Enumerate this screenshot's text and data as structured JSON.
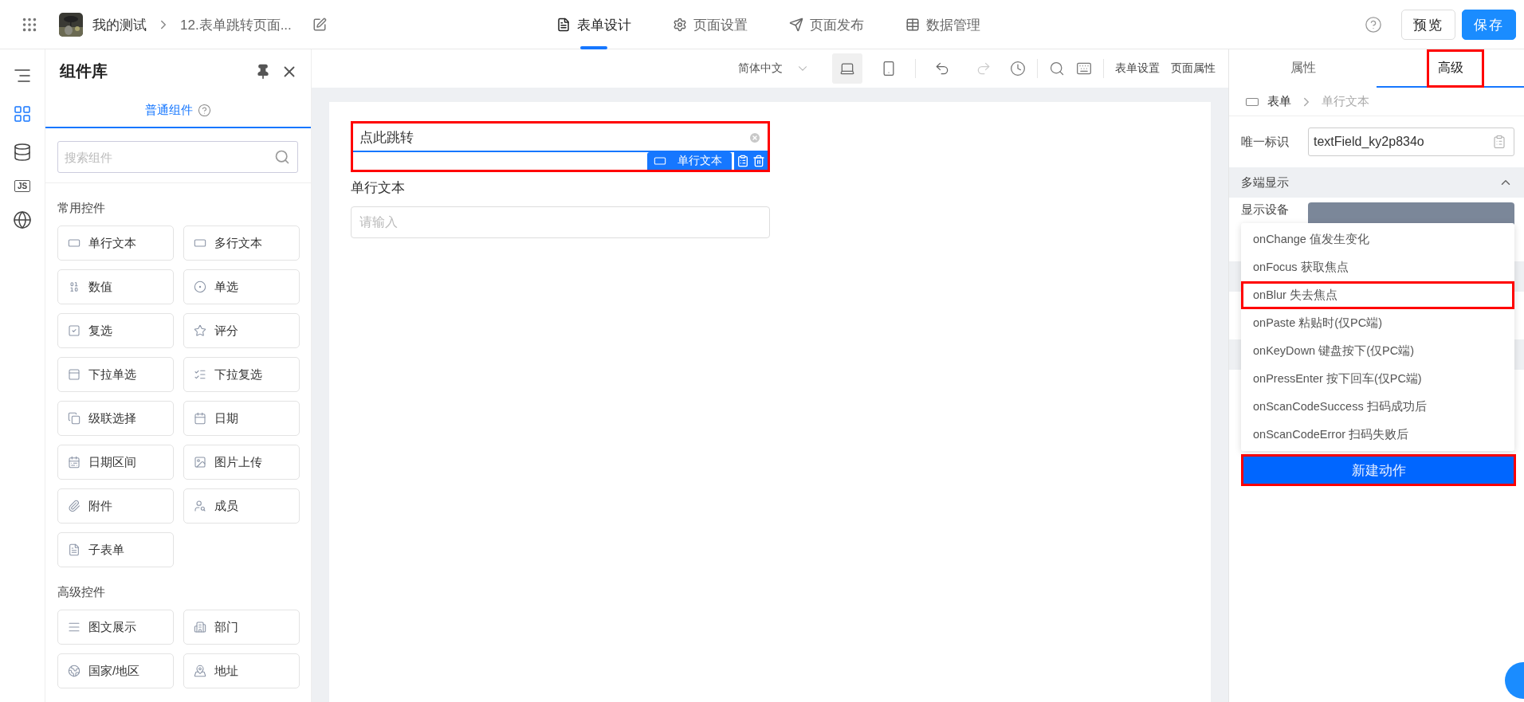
{
  "header": {
    "app": "我的测试",
    "page": "12.表单跳转页面...",
    "tabs": [
      {
        "label": "表单设计",
        "selected": true
      },
      {
        "label": "页面设置",
        "selected": false
      },
      {
        "label": "页面发布",
        "selected": false
      },
      {
        "label": "数据管理",
        "selected": false
      }
    ],
    "buttons": [
      {
        "label": "预览",
        "kind": "secondary"
      },
      {
        "label": "保存",
        "kind": "primary"
      }
    ]
  },
  "rail": [
    {
      "selected": false
    },
    {
      "selected": true
    },
    {
      "selected": false
    },
    {
      "label": "JS",
      "selected": false
    },
    {
      "selected": false
    }
  ],
  "library": {
    "title": "组件库",
    "tab": {
      "label": "普通组件",
      "selected": true
    },
    "search": {
      "placeholder": "搜索组件"
    },
    "sections": [
      {
        "title": "常用控件",
        "items": [
          "单行文本",
          "多行文本",
          "数值",
          "单选",
          "复选",
          "评分",
          "下拉单选",
          "下拉复选",
          "级联选择",
          "日期",
          "日期区间",
          "图片上传",
          "附件",
          "成员",
          "子表单"
        ]
      },
      {
        "title": "高级控件",
        "items": [
          "图文展示",
          "部门",
          "国家/地区",
          "地址"
        ]
      }
    ]
  },
  "toolbar": {
    "language": "简体中文",
    "devices": [
      {
        "selected": true
      },
      {
        "selected": false
      }
    ],
    "history": [
      {
        "disabled": false
      },
      {
        "disabled": true
      }
    ],
    "links": [
      "表单设置",
      "页面属性"
    ]
  },
  "canvas": {
    "selected_field": {
      "value": "点此跳转",
      "tag": "单行文本",
      "highlighted": true
    },
    "fields": [
      {
        "label": "单行文本",
        "placeholder": "请输入"
      }
    ]
  },
  "inspector": {
    "tabs": [
      {
        "label": "属性",
        "selected": false,
        "highlighted": false
      },
      {
        "label": "高级",
        "selected": true,
        "highlighted": true
      }
    ],
    "breadcrumb": [
      "表单",
      "单行文本"
    ],
    "id_row": {
      "label": "唯一标识",
      "value": "textField_ky2p834o"
    },
    "section": {
      "title": "多端显示",
      "expanded": true
    },
    "device_row": {
      "label": "显示设备"
    },
    "events": [
      {
        "label": "onChange 值发生变化",
        "highlighted": false
      },
      {
        "label": "onFocus 获取焦点",
        "highlighted": false
      },
      {
        "label": "onBlur 失去焦点",
        "highlighted": true
      },
      {
        "label": "onPaste 粘贴时(仅PC端)",
        "highlighted": false
      },
      {
        "label": "onKeyDown 键盘按下(仅PC端)",
        "highlighted": false
      },
      {
        "label": "onPressEnter 按下回车(仅PC端)",
        "highlighted": false
      },
      {
        "label": "onScanCodeSuccess 扫码成功后",
        "highlighted": false
      },
      {
        "label": "onScanCodeError 扫码失败后",
        "highlighted": false
      }
    ],
    "action_button": {
      "label": "新建动作",
      "highlighted": true
    }
  }
}
